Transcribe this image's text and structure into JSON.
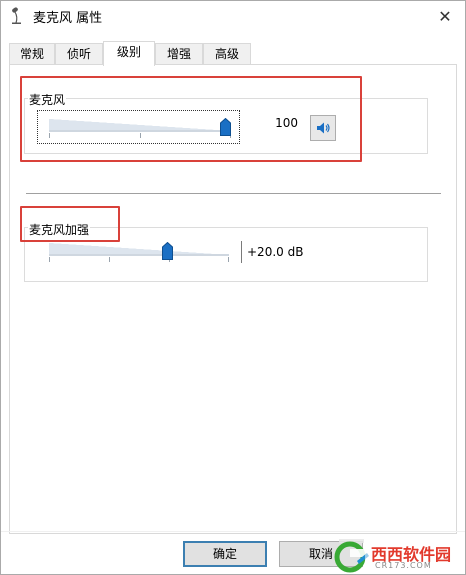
{
  "window": {
    "title": "麦克风 属性",
    "close_glyph": "✕"
  },
  "tabs": [
    {
      "label": "常规"
    },
    {
      "label": "侦听"
    },
    {
      "label": "级别"
    },
    {
      "label": "增强"
    },
    {
      "label": "高级"
    }
  ],
  "active_tab": "级别",
  "microphone": {
    "label": "麦克风",
    "value_text": "100",
    "level": 1.0
  },
  "boost": {
    "label": "麦克风加强",
    "value_text": "+20.0 dB",
    "level": 0.67
  },
  "buttons": {
    "ok": "确定",
    "cancel": "取消"
  },
  "watermark": {
    "brand": "西西软件园",
    "domain": "CR173.COM"
  },
  "colors": {
    "accent": "#1a6fc4",
    "highlight_red": "#d9413a"
  },
  "icons": {
    "title": "microphone-icon",
    "speaker": "speaker-icon",
    "close": "close-icon"
  }
}
